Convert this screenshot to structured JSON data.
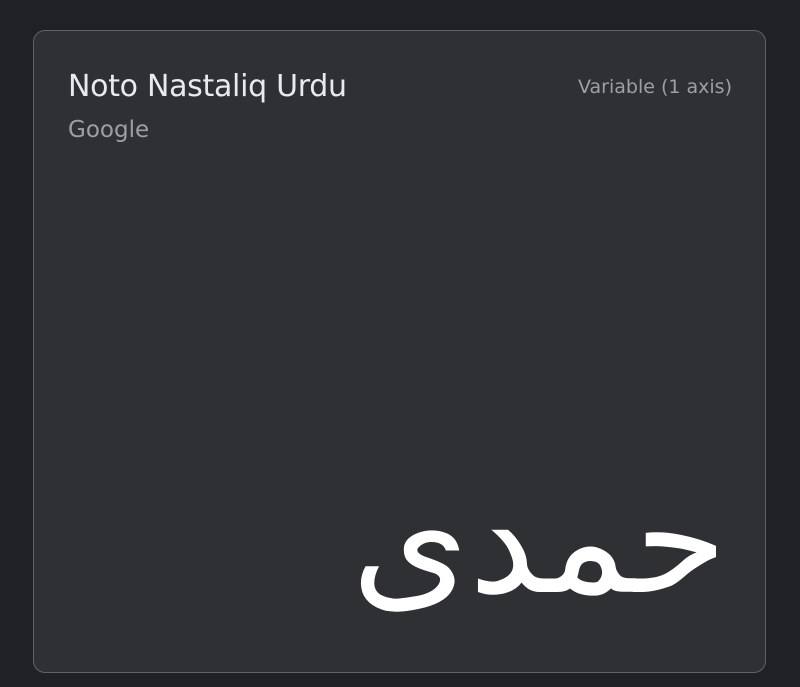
{
  "card": {
    "font_name": "Noto Nastaliq Urdu",
    "foundry": "Google",
    "axis_info": "Variable (1 axis)",
    "preview_text": "حمدی"
  }
}
